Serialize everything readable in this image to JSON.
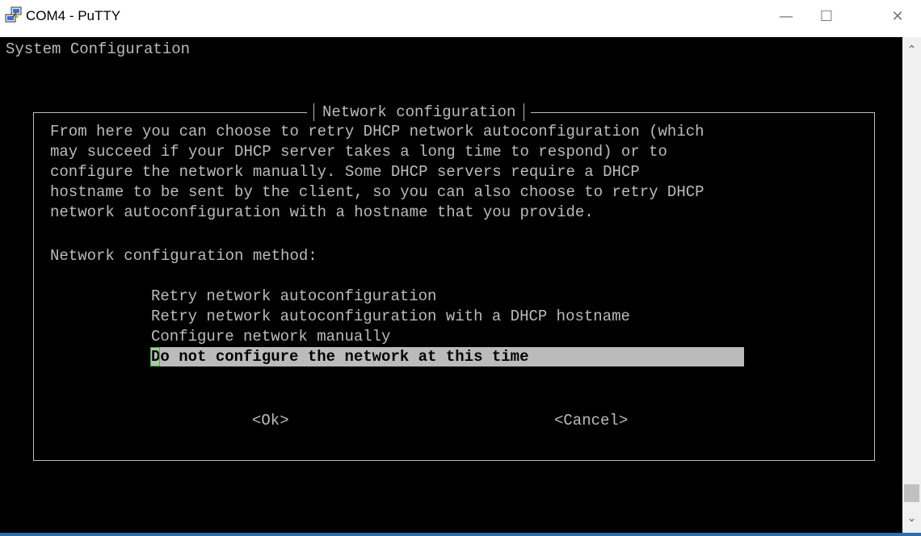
{
  "window": {
    "title": "COM4 - PuTTY",
    "icon": "putty-computer-icon",
    "minimize_glyph": "—",
    "maximize_glyph": "☐",
    "close_glyph": "✕"
  },
  "terminal": {
    "header": "System Configuration",
    "dialog": {
      "title": "Network configuration",
      "description_lines": [
        "From here you can choose to retry DHCP network autoconfiguration (which",
        "may succeed if your DHCP server takes a long time to respond) or to",
        "configure the network manually. Some DHCP servers require a DHCP",
        "hostname to be sent by the client, so you can also choose to retry DHCP",
        "network autoconfiguration with a hostname that you provide."
      ],
      "prompt": "Network configuration method:",
      "options": [
        "Retry network autoconfiguration",
        "Retry network autoconfiguration with a DHCP hostname",
        "Configure network manually",
        "Do not configure the network at this time"
      ],
      "selected_index": 3,
      "ok_label": "<Ok>",
      "cancel_label": "<Cancel>"
    }
  },
  "scrollbar": {
    "up_glyph": "⌃",
    "down_glyph": "⌄"
  },
  "colors": {
    "terminal_bg": "#000000",
    "terminal_fg": "#bbbbbb",
    "highlight_bg": "#bbbbbb",
    "cursor": "#22cc22"
  }
}
